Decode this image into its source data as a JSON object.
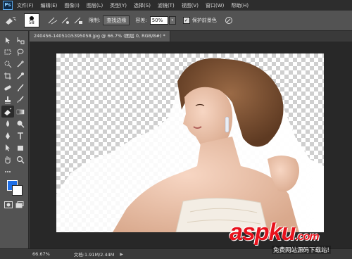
{
  "app": {
    "logo": "Ps"
  },
  "menu": [
    "文件(F)",
    "编辑(E)",
    "图像(I)",
    "图层(L)",
    "类型(Y)",
    "选择(S)",
    "滤镜(T)",
    "视图(V)",
    "窗口(W)",
    "帮助(H)"
  ],
  "options": {
    "brush_size": "58",
    "limits_label": "限制:",
    "limits_value": "查找边缘",
    "tolerance_label": "容差:",
    "tolerance_value": "50%",
    "protect_label": "保护前景色"
  },
  "tools": [
    "move-tool-icon",
    "artboard-icon",
    "marquee-icon",
    "lasso-icon",
    "quick-select-icon",
    "magic-wand-icon",
    "crop-icon",
    "eyedropper-icon",
    "healing-icon",
    "brush-icon",
    "clone-stamp-icon",
    "history-brush-icon",
    "background-eraser-icon",
    "gradient-icon",
    "blur-icon",
    "dodge-icon",
    "pen-icon",
    "type-icon",
    "path-select-icon",
    "shape-icon",
    "hand-icon",
    "zoom-icon"
  ],
  "colors": {
    "foreground": "#1f6fe6",
    "background": "#ffffff"
  },
  "document": {
    "tab_title": "240456-14051G5395058.jpg @ 66.7% (图层 0, RGB/8#) *"
  },
  "status": {
    "zoom": "66.67%",
    "doc_info": "文档:1.91M/2.44M"
  },
  "watermark": {
    "brand": "aspku",
    "tld": ".com",
    "subtitle": "免费网站源码下载站!"
  }
}
